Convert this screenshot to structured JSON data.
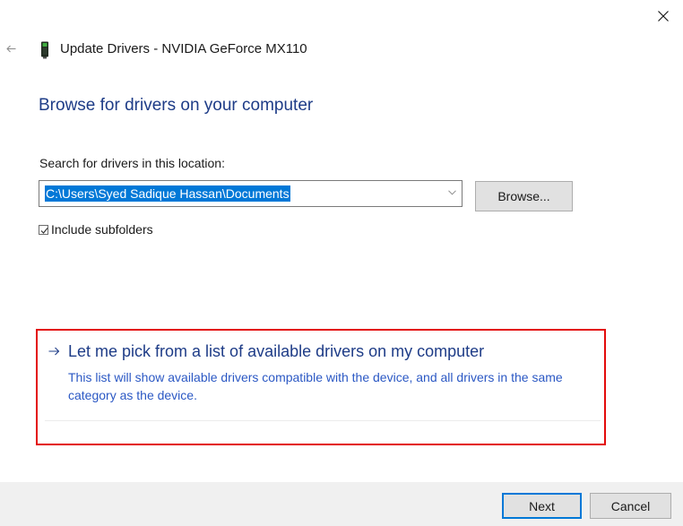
{
  "window": {
    "title": "Update Drivers - NVIDIA GeForce MX110",
    "icons": {
      "close": "close-icon",
      "back": "back-arrow-icon",
      "device": "display-adapter-icon"
    }
  },
  "main": {
    "heading": "Browse for drivers on your computer",
    "search_label": "Search for drivers in this location:",
    "location_value": "C:\\Users\\Syed Sadique Hassan\\Documents",
    "browse_label": "Browse...",
    "include_subfolders_label": "Include subfolders",
    "include_subfolders_checked": true
  },
  "pick_option": {
    "title": "Let me pick from a list of available drivers on my computer",
    "description": "This list will show available drivers compatible with the device, and all drivers in the same category as the device.",
    "highlight_color": "#e30b0b"
  },
  "footer": {
    "next_label": "Next",
    "cancel_label": "Cancel"
  },
  "colors": {
    "heading": "#1e3c87",
    "link": "#2b58c4",
    "selection": "#0078d7",
    "footer_bg": "#f0f0f0"
  }
}
